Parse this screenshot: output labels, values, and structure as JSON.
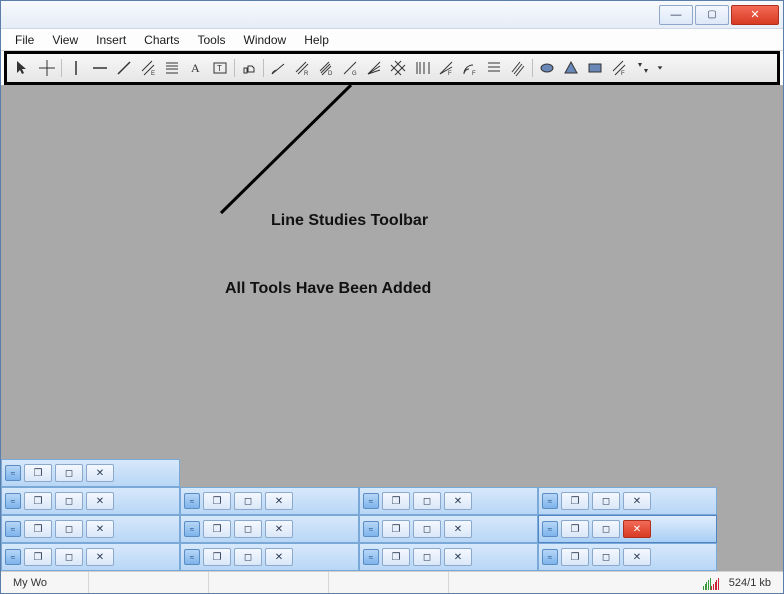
{
  "title_buttons": {
    "min": "minimize",
    "max": "restore",
    "close": "close"
  },
  "menu": [
    "File",
    "View",
    "Insert",
    "Charts",
    "Tools",
    "Window",
    "Help"
  ],
  "toolbar_icons": [
    "cursor-icon",
    "crosshair-icon",
    "vertical-line-icon",
    "horizontal-line-icon",
    "trend-line-icon",
    "equidistant-channel-icon",
    "fibonacci-retracement-icon",
    "text-label-icon",
    "text-box-icon",
    "thumbs-icon",
    "trendline-by-angle-icon",
    "linear-regression-channel-icon",
    "stddev-channel-icon",
    "gann-line-icon",
    "gann-fan-icon",
    "gann-grid-icon",
    "fibo-time-zone-icon",
    "fibo-fan-icon",
    "fibo-arcs-icon",
    "fibo-channel-icon",
    "fibo-expansion-icon",
    "ellipse-icon",
    "triangle-icon",
    "rectangle-icon",
    "andrews-pitchfork-icon",
    "cycle-lines-icon"
  ],
  "annotation": {
    "line1": "Line Studies Toolbar",
    "line2": "All Tools Have Been Added"
  },
  "sub_windows": {
    "rows": [
      [
        {
          "active": false
        }
      ],
      [
        {
          "active": false
        },
        {
          "active": false
        },
        {
          "active": false
        },
        {
          "active": false
        }
      ],
      [
        {
          "active": false
        },
        {
          "active": false
        },
        {
          "active": false
        },
        {
          "active": true,
          "closebtn_red": true
        }
      ],
      [
        {
          "active": false
        },
        {
          "active": false
        },
        {
          "active": false
        },
        {
          "active": false
        }
      ]
    ]
  },
  "statusbar": {
    "left": "My Wo",
    "net": "524/1 kb"
  }
}
